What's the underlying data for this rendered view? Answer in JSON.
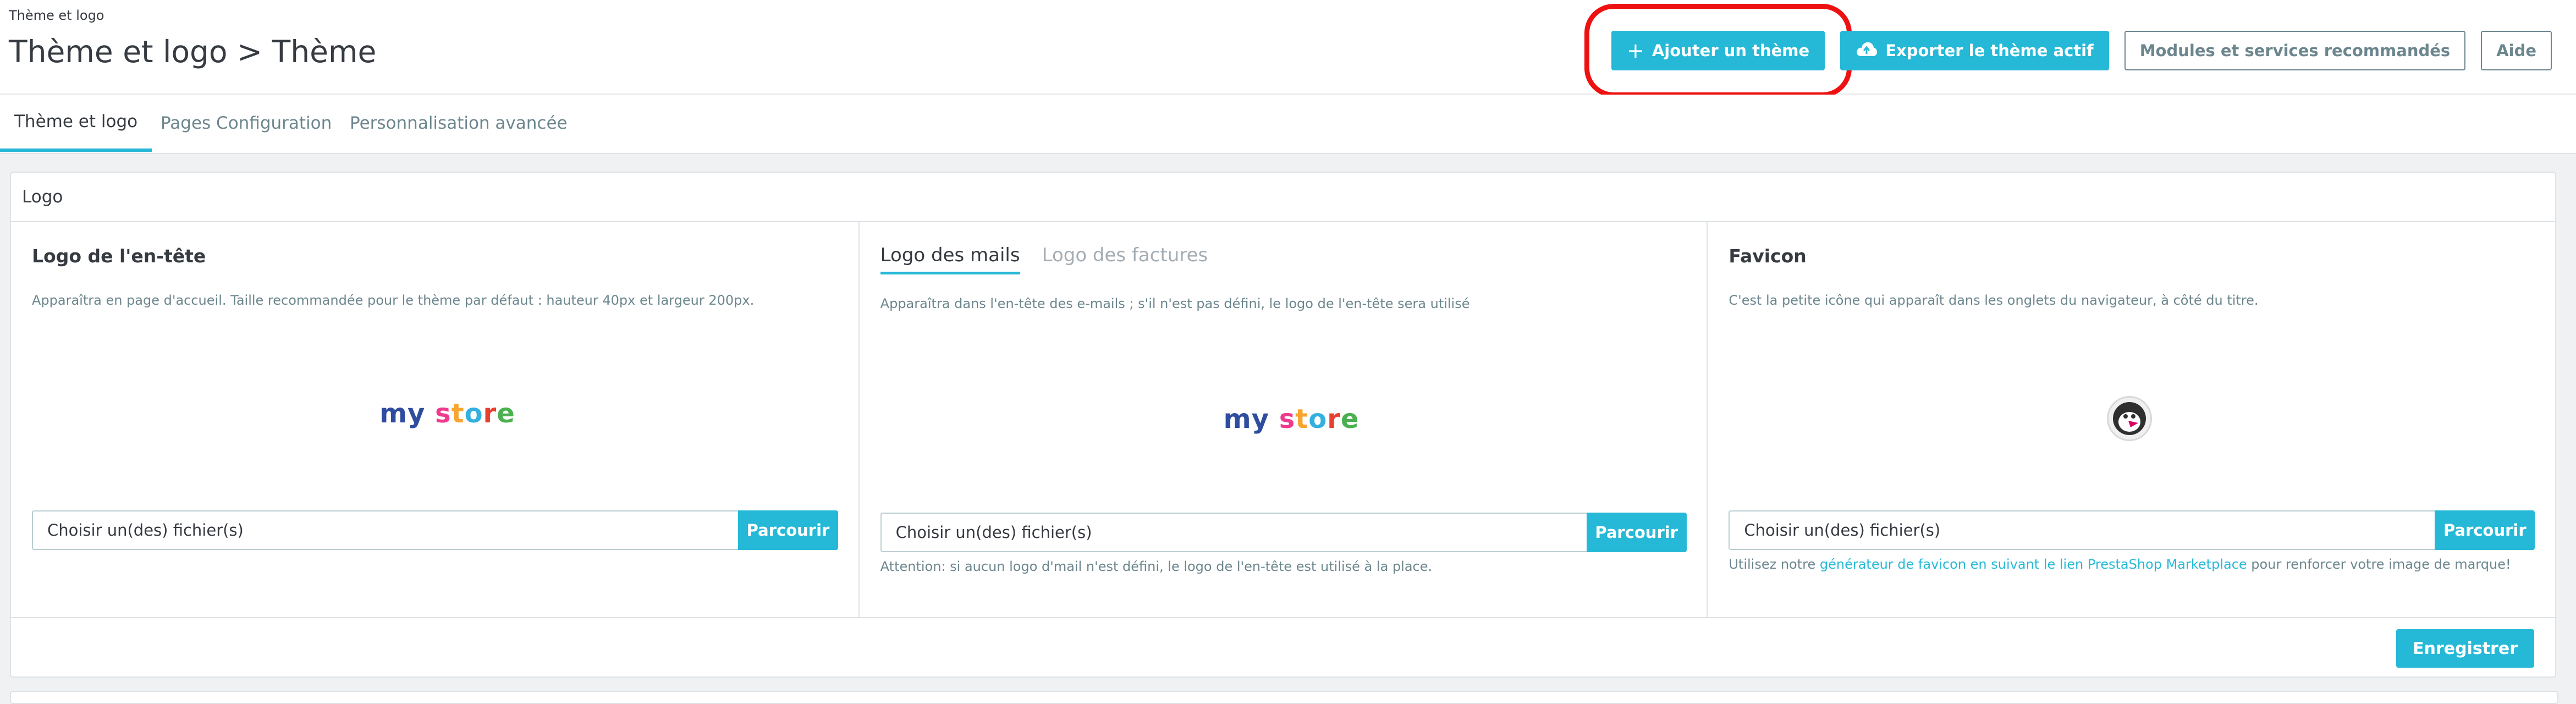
{
  "breadcrumb": "Thème et logo",
  "page_title": "Thème et logo > Thème",
  "toolbar": {
    "add_theme": "Ajouter un thème",
    "export_theme": "Exporter le thème actif",
    "recommended": "Modules et services recommandés",
    "help": "Aide"
  },
  "tabs": [
    "Thème et logo",
    "Pages Configuration",
    "Personnalisation avancée"
  ],
  "card": {
    "title": "Logo",
    "header_logo": {
      "title": "Logo de l'en-tête",
      "desc": "Apparaîtra en page d'accueil. Taille recommandée pour le thème par défaut : hauteur 40px et largeur 200px.",
      "logo": {
        "my": "my",
        "s": "s",
        "t": "t",
        "o": "o",
        "r": "r",
        "e": "e"
      }
    },
    "mail_logo": {
      "tab_active": "Logo des mails",
      "tab_inactive": "Logo des factures",
      "desc": "Apparaîtra dans l'en-tête des e-mails ; s'il n'est pas défini, le logo de l'en-tête sera utilisé",
      "help": "Attention: si aucun logo d'mail n'est défini, le logo de l'en-tête est utilisé à la place."
    },
    "favicon": {
      "title": "Favicon",
      "desc": "C'est la petite icône qui apparaît dans les onglets du navigateur, à côté du titre.",
      "help_before": "Utilisez notre ",
      "help_link": "générateur de favicon en suivant le lien PrestaShop Marketplace",
      "help_after": " pour renforcer votre image de marque!"
    },
    "file_placeholder": "Choisir un(des) fichier(s)",
    "browse": "Parcourir",
    "save": "Enregistrer"
  },
  "colors": {
    "accent": "#25b9d7",
    "highlight": "#ee1111"
  }
}
